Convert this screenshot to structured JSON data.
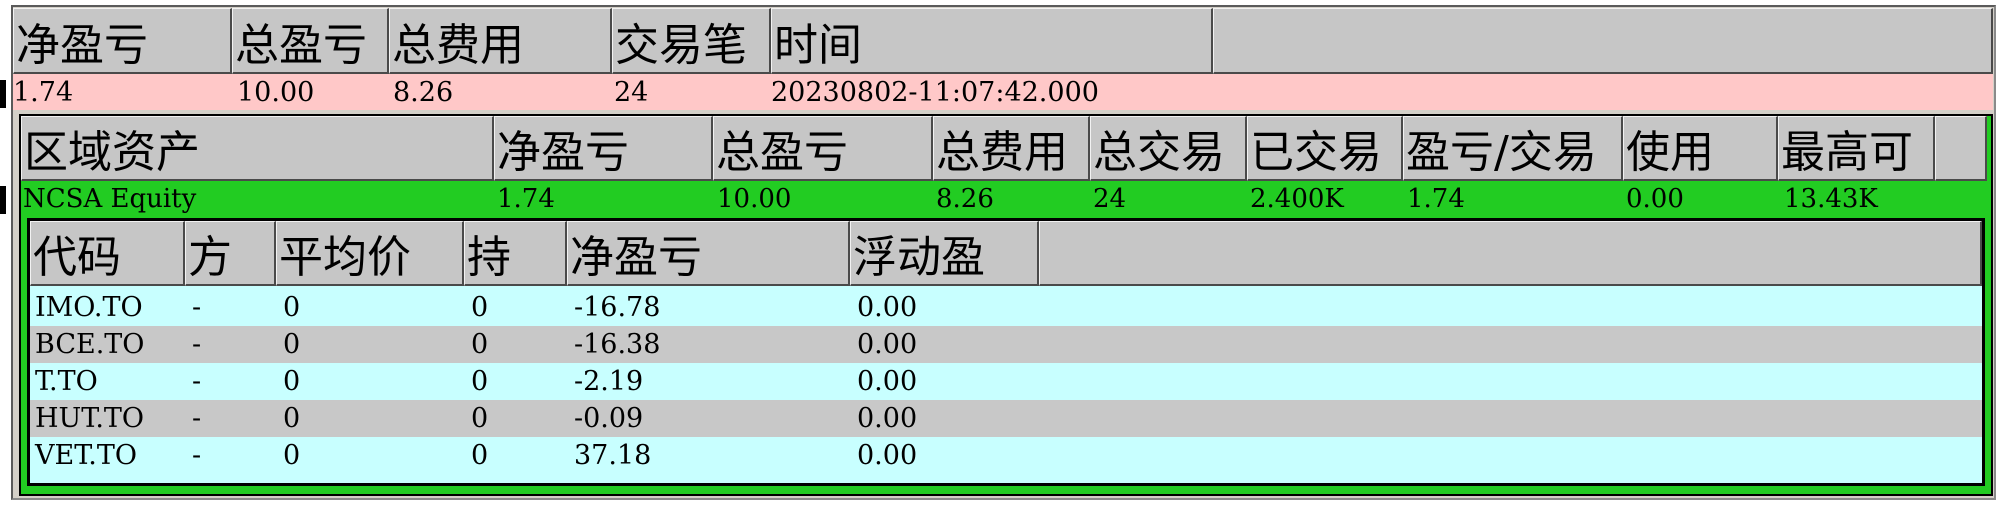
{
  "summary": {
    "headers": [
      "净盈亏",
      "总盈亏",
      "总费用",
      "交易笔",
      "时间",
      ""
    ],
    "values": {
      "net_pnl": "1.74",
      "gross_pnl": "10.00",
      "fees": "8.26",
      "trades": "24",
      "time": "20230802-11:07:42.000"
    }
  },
  "region": {
    "headers": [
      "区域资产",
      "净盈亏",
      "总盈亏",
      "总费用",
      "总交易",
      "已交易",
      "盈亏/交易",
      "使用",
      "最高可",
      ""
    ],
    "values": {
      "name": "NCSA Equity",
      "net_pnl": "1.74",
      "gross_pnl": "10.00",
      "fees": "8.26",
      "total_trades": "24",
      "traded": "2.400K",
      "pnl_per_trade": "1.74",
      "used": "0.00",
      "max_available": "13.43K"
    }
  },
  "positions": {
    "headers": [
      "代码",
      "方",
      "平均价",
      "持",
      "净盈亏",
      "浮动盈",
      ""
    ],
    "rows": [
      {
        "symbol": "IMO.TO",
        "side": "-",
        "avg_price": "0",
        "qty": "0",
        "net_pnl": "-16.78",
        "float_pnl": "0.00"
      },
      {
        "symbol": "BCE.TO",
        "side": "-",
        "avg_price": "0",
        "qty": "0",
        "net_pnl": "-16.38",
        "float_pnl": "0.00"
      },
      {
        "symbol": "T.TO",
        "side": "-",
        "avg_price": "0",
        "qty": "0",
        "net_pnl": "-2.19",
        "float_pnl": "0.00"
      },
      {
        "symbol": "HUT.TO",
        "side": "-",
        "avg_price": "0",
        "qty": "0",
        "net_pnl": "-0.09",
        "float_pnl": "0.00"
      },
      {
        "symbol": "VET.TO",
        "side": "-",
        "avg_price": "0",
        "qty": "0",
        "net_pnl": "37.18",
        "float_pnl": "0.00"
      }
    ]
  },
  "colors": {
    "summary_row": "#ffc8c8",
    "region_row": "#22cc22",
    "row_cyan": "#c8ffff",
    "row_gray": "#c8c8c8",
    "header_gray": "#c6c6c6"
  }
}
